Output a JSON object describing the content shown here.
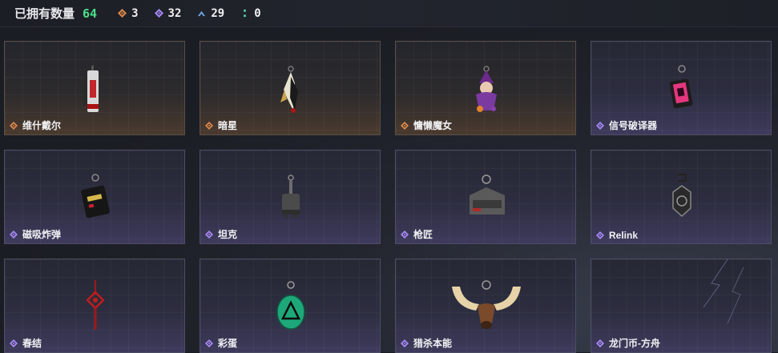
{
  "header": {
    "owned_label": "已拥有数量",
    "owned_count": "64",
    "stats": [
      {
        "icon": "orange-diamond-icon",
        "color": "#e08a4a",
        "value": "3"
      },
      {
        "icon": "purple-diamond-icon",
        "color": "#a78bfa",
        "value": "32"
      },
      {
        "icon": "blue-chevron-icon",
        "color": "#6aa6e6",
        "value": "29"
      },
      {
        "icon": "teal-dots-icon",
        "color": "#4fd1a5",
        "value": "0"
      }
    ]
  },
  "colors": {
    "rarity_orange": "#e08a4a",
    "rarity_purple": "#a78bfa",
    "count_green": "#4be08a"
  },
  "items": [
    {
      "name": "维什戴尔",
      "rarity": "orange"
    },
    {
      "name": "暗星",
      "rarity": "orange"
    },
    {
      "name": "慵懒魔女",
      "rarity": "orange"
    },
    {
      "name": "信号破译器",
      "rarity": "purple"
    },
    {
      "name": "磁吸炸弹",
      "rarity": "purple"
    },
    {
      "name": "坦克",
      "rarity": "purple"
    },
    {
      "name": "枪匠",
      "rarity": "purple"
    },
    {
      "name": "Relink",
      "rarity": "purple"
    },
    {
      "name": "春结",
      "rarity": "purple"
    },
    {
      "name": "彩蛋",
      "rarity": "purple"
    },
    {
      "name": "猎杀本能",
      "rarity": "purple"
    },
    {
      "name": "龙门币-方舟",
      "rarity": "purple"
    }
  ]
}
